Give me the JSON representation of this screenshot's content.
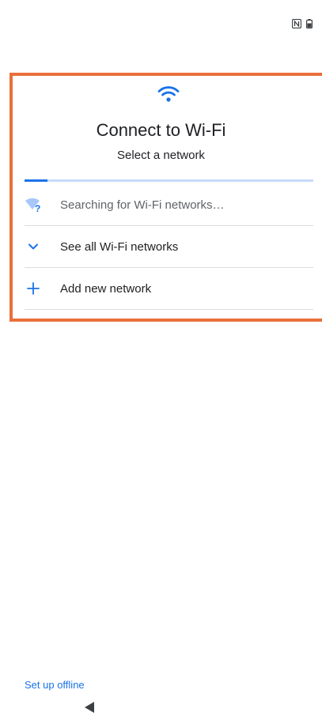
{
  "status_bar": {
    "icons": [
      "nfc-icon",
      "battery-icon"
    ]
  },
  "header": {
    "icon": "wifi-icon",
    "title": "Connect to Wi-Fi",
    "subtitle": "Select a network"
  },
  "progress": {
    "fraction": 0.08,
    "color": "#1a73e8",
    "track_color": "#c6dafc"
  },
  "list": {
    "items": [
      {
        "icon": "wifi-searching-icon",
        "label": "Searching for Wi-Fi networks…"
      },
      {
        "icon": "chevron-down-icon",
        "label": "See all Wi-Fi networks"
      },
      {
        "icon": "plus-icon",
        "label": "Add new network"
      }
    ]
  },
  "footer": {
    "offline_label": "Set up offline"
  },
  "nav": {
    "back_icon": "back-triangle-icon"
  },
  "colors": {
    "accent": "#1a73e8",
    "highlight": "#e8703a",
    "divider": "#dadce0"
  }
}
